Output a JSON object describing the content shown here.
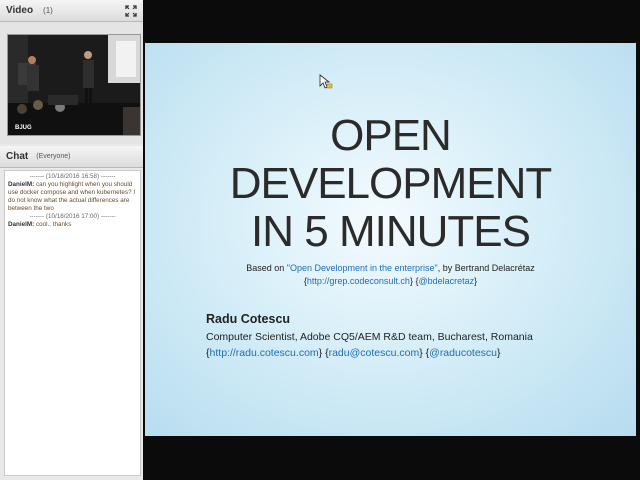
{
  "video_panel": {
    "title": "Video",
    "count": "(1)",
    "stream_label": "BJUG"
  },
  "chat_panel": {
    "title": "Chat",
    "audience": "(Everyone)",
    "messages": [
      {
        "separator": "------- (10/18/2016 16:58) -------",
        "user": "DanielM:",
        "text": "can you highlight when you should use docker compose and when kubernetes? I do not know what the actual differences are between the two"
      },
      {
        "separator": "------- (10/18/2016 17:00) -------",
        "user": "DanielM:",
        "text": "cool.. thanks"
      }
    ]
  },
  "slide": {
    "title_lines": [
      "OPEN",
      "DEVELOPMENT",
      "IN 5 MINUTES"
    ],
    "based_on_prefix": "Based on ",
    "based_on_link": "\"Open Development in the enterprise\"",
    "based_on_suffix": ", by Bertrand Delacrétaz",
    "source_open": "{",
    "source_url": "http://grep.codeconsult.ch",
    "source_mid": "} {",
    "source_handle": "@bdelacretaz",
    "source_close": "}",
    "author": "Radu Cotescu",
    "role": "Computer Scientist, Adobe CQ5/AEM R&D team, Bucharest, Romania",
    "contacts": {
      "open": "{",
      "site": "http://radu.cotescu.com",
      "sep1": "} {",
      "email": "radu@cotescu.com",
      "sep2": "} {",
      "handle": "@raducotescu",
      "close": "}"
    }
  },
  "colors": {
    "link": "#1f6db3",
    "slide_bg": "#cfeaf6",
    "stage_bg": "#0b0b0b"
  }
}
